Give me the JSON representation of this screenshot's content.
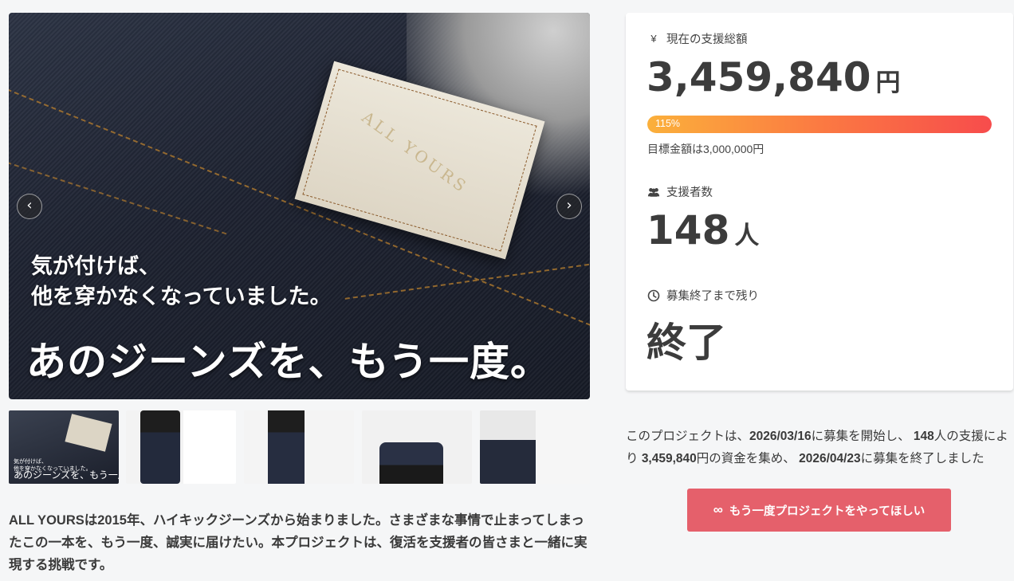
{
  "hero": {
    "patch_text": "ALL YOURS",
    "subtitle": "気が付けば、\n他を穿かなくなっていました。",
    "headline": "あのジーンズを、もう一度。",
    "prev_icon": "chevron-left-icon",
    "next_icon": "chevron-right-icon",
    "prev_glyph": "‹",
    "next_glyph": "›"
  },
  "thumbnails": [
    {
      "name": "thumb-1",
      "small_text": "気が付けば、\n他を穿かなくなっていました。",
      "main_text": "あのジーンズを、もう一度。"
    },
    {
      "name": "thumb-2"
    },
    {
      "name": "thumb-3"
    },
    {
      "name": "thumb-4"
    },
    {
      "name": "thumb-5"
    }
  ],
  "description": "ALL YOURSは2015年、ハイキックジーンズから始まりました。さまざまな事情で止まってしまったこの一本を、もう一度、誠実に届けたい。本プロジェクトは、復活を支援者の皆さまと一緒に実現する挑戦です。",
  "stats": {
    "total": {
      "icon": "yen-icon",
      "icon_glyph": "¥",
      "label": "現在の支援総額",
      "amount": "3,459,840",
      "unit": "円"
    },
    "progress": {
      "percent_label": "115%",
      "fill_fraction": 1.0,
      "goal_text": "目標金額は3,000,000円"
    },
    "backers": {
      "icon": "users-icon",
      "label": "支援者数",
      "count": "148",
      "unit": "人"
    },
    "remaining": {
      "icon": "clock-icon",
      "label": "募集終了まで残り",
      "value": "終了"
    }
  },
  "summary": {
    "prefix": "このプロジェクトは、",
    "start_date": "2026/03/16",
    "part2": "に募集を開始し、 ",
    "backers": "148",
    "part3": "人の支援により ",
    "amount": "3,459,840",
    "part4": "円の資金を集め、 ",
    "end_date": "2026/04/23",
    "part5": "に募集を終了しました"
  },
  "cta": {
    "icon": "infinity-icon",
    "icon_glyph": "∞",
    "label": "もう一度プロジェクトをやってほしい"
  },
  "colors": {
    "accent": "#e5606b",
    "progress_start": "#fbb03b",
    "progress_end": "#f74c4c",
    "page_bg": "#f5f6f7"
  }
}
